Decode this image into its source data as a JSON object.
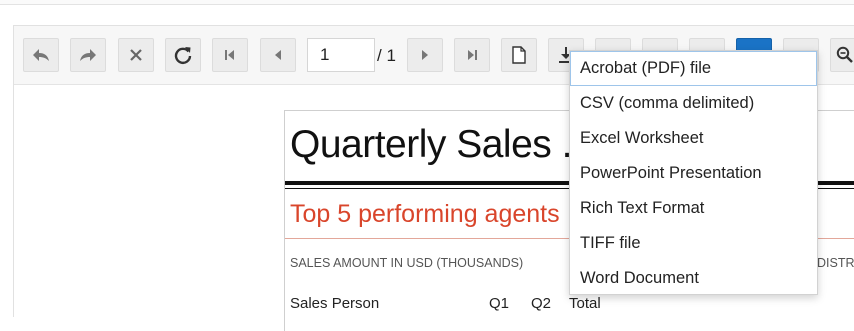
{
  "toolbar": {
    "buttons": [
      {
        "name": "undo-button",
        "icon": "undo-icon"
      },
      {
        "name": "redo-button",
        "icon": "redo-icon"
      },
      {
        "name": "cancel-button",
        "icon": "close-icon"
      },
      {
        "name": "refresh-button",
        "icon": "refresh-icon"
      },
      {
        "name": "first-page-button",
        "icon": "first-page-icon"
      },
      {
        "name": "previous-page-button",
        "icon": "previous-page-icon"
      },
      {
        "name": "next-page-button",
        "icon": "next-page-icon"
      },
      {
        "name": "last-page-button",
        "icon": "last-page-icon"
      },
      {
        "name": "print-layout-button",
        "icon": "document-icon"
      },
      {
        "name": "export-button",
        "icon": "download-icon"
      },
      {
        "name": "find-button",
        "icon": "zoom-icon"
      }
    ],
    "page_input_value": "1",
    "page_total": "/ 1",
    "active_color": "#1a73c6"
  },
  "report": {
    "title": "Quarterly Sales .",
    "subtitle": "Top 5 performing agents",
    "caption": "SALES AMOUNT IN USD (THOUSANDS)",
    "caption_right": "DISTRI",
    "columns": [
      "Sales Person",
      "Q1",
      "Q2",
      "Total"
    ],
    "accent_color": "#d9452b"
  },
  "export_menu": {
    "items": [
      {
        "label": "Acrobat (PDF) file",
        "selected": true
      },
      {
        "label": "CSV (comma delimited)",
        "selected": false
      },
      {
        "label": "Excel Worksheet",
        "selected": false
      },
      {
        "label": "PowerPoint Presentation",
        "selected": false
      },
      {
        "label": "Rich Text Format",
        "selected": false
      },
      {
        "label": "TIFF file",
        "selected": false
      },
      {
        "label": "Word Document",
        "selected": false
      }
    ]
  }
}
